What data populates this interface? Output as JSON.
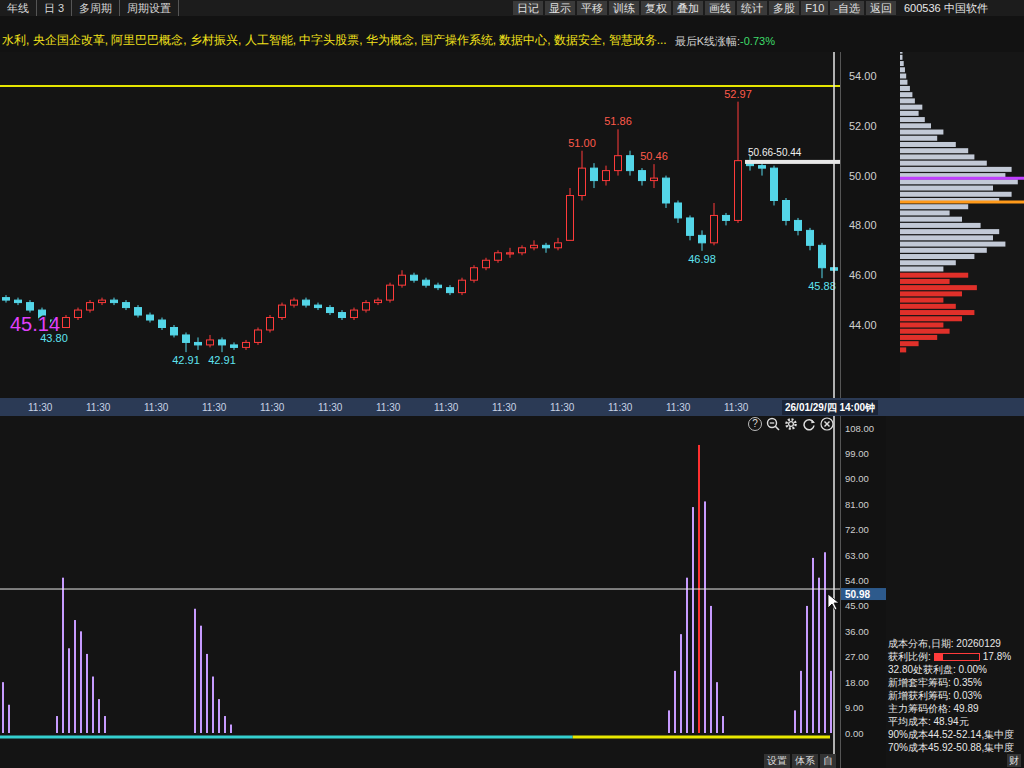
{
  "toolbar": {
    "left": [
      "年线",
      "日 3",
      "多周期",
      "周期设置"
    ],
    "right": [
      "日记",
      "显示",
      "平移",
      "训练",
      "复权",
      "叠加",
      "画线",
      "统计",
      "多股",
      "F10",
      "-自选",
      "返回"
    ],
    "stock": "600536 中国软件"
  },
  "tags": {
    "concepts": "水利, 央企国企改革, 阿里巴巴概念, 乡村振兴, 人工智能, 中字头股票, 华为概念, 国产操作系统, 数据中心, 数据安全, 智慧政务...",
    "last_change_label": "最后K线涨幅:",
    "last_change_value": "-0.73%"
  },
  "chart": {
    "price_ticks": [
      {
        "label": "54.00",
        "value": 54
      },
      {
        "label": "52.00",
        "value": 52
      },
      {
        "label": "50.00",
        "value": 50
      },
      {
        "label": "48.00",
        "value": 48
      },
      {
        "label": "46.00",
        "value": 46
      },
      {
        "label": "44.00",
        "value": 44
      }
    ],
    "resistance_line": 53.6,
    "candles": [
      [
        45.1,
        45.2,
        44.9,
        45.0
      ],
      [
        45.0,
        45.1,
        44.8,
        44.9
      ],
      [
        44.9,
        45.0,
        44.5,
        44.6
      ],
      [
        44.6,
        44.7,
        44.1,
        44.2
      ],
      [
        44.2,
        44.3,
        43.8,
        43.9
      ],
      [
        43.9,
        44.4,
        43.9,
        44.3
      ],
      [
        44.3,
        44.7,
        44.2,
        44.6
      ],
      [
        44.6,
        45.0,
        44.5,
        44.9
      ],
      [
        44.9,
        45.1,
        44.8,
        45.0
      ],
      [
        45.0,
        45.1,
        44.8,
        44.9
      ],
      [
        44.9,
        45.0,
        44.6,
        44.7
      ],
      [
        44.7,
        44.8,
        44.3,
        44.4
      ],
      [
        44.4,
        44.5,
        44.1,
        44.2
      ],
      [
        44.2,
        44.3,
        43.8,
        43.9
      ],
      [
        43.9,
        44.0,
        43.5,
        43.6
      ],
      [
        43.6,
        43.7,
        42.91,
        43.3
      ],
      [
        43.3,
        43.5,
        43.0,
        43.2
      ],
      [
        43.2,
        43.6,
        43.1,
        43.4
      ],
      [
        43.4,
        43.5,
        42.91,
        43.2
      ],
      [
        43.2,
        43.3,
        43.0,
        43.1
      ],
      [
        43.1,
        43.4,
        43.0,
        43.3
      ],
      [
        43.3,
        43.9,
        43.2,
        43.8
      ],
      [
        43.8,
        44.4,
        43.7,
        44.3
      ],
      [
        44.3,
        44.9,
        44.2,
        44.8
      ],
      [
        44.8,
        45.1,
        44.7,
        45.0
      ],
      [
        45.0,
        45.1,
        44.7,
        44.8
      ],
      [
        44.8,
        44.9,
        44.6,
        44.7
      ],
      [
        44.7,
        44.8,
        44.4,
        44.5
      ],
      [
        44.5,
        44.6,
        44.2,
        44.3
      ],
      [
        44.3,
        44.7,
        44.2,
        44.6
      ],
      [
        44.6,
        45.0,
        44.5,
        44.9
      ],
      [
        44.9,
        45.1,
        44.8,
        45.0
      ],
      [
        45.0,
        45.7,
        44.9,
        45.6
      ],
      [
        45.6,
        46.2,
        45.5,
        46.0
      ],
      [
        46.0,
        46.1,
        45.7,
        45.8
      ],
      [
        45.8,
        45.9,
        45.5,
        45.6
      ],
      [
        45.6,
        45.7,
        45.4,
        45.5
      ],
      [
        45.5,
        45.6,
        45.2,
        45.3
      ],
      [
        45.3,
        45.9,
        45.2,
        45.8
      ],
      [
        45.8,
        46.4,
        45.7,
        46.3
      ],
      [
        46.3,
        46.7,
        46.2,
        46.6
      ],
      [
        46.6,
        47.0,
        46.5,
        46.9
      ],
      [
        46.9,
        47.1,
        46.7,
        46.9
      ],
      [
        46.9,
        47.2,
        46.8,
        47.1
      ],
      [
        47.1,
        47.4,
        47.0,
        47.2
      ],
      [
        47.2,
        47.3,
        46.9,
        47.1
      ],
      [
        47.1,
        47.5,
        47.0,
        47.3
      ],
      [
        47.4,
        49.5,
        47.4,
        49.2
      ],
      [
        49.2,
        51.0,
        49.0,
        50.3
      ],
      [
        50.3,
        50.5,
        49.5,
        49.8
      ],
      [
        49.8,
        50.4,
        49.6,
        50.2
      ],
      [
        50.2,
        51.86,
        50.0,
        50.8
      ],
      [
        50.8,
        51.0,
        50.0,
        50.2
      ],
      [
        50.2,
        50.3,
        49.6,
        49.8
      ],
      [
        49.8,
        50.46,
        49.5,
        49.9
      ],
      [
        49.9,
        50.0,
        48.7,
        48.9
      ],
      [
        48.9,
        49.0,
        48.1,
        48.3
      ],
      [
        48.3,
        48.4,
        47.4,
        47.6
      ],
      [
        47.6,
        47.8,
        46.98,
        47.3
      ],
      [
        47.3,
        48.9,
        47.2,
        48.4
      ],
      [
        48.4,
        48.5,
        48.0,
        48.2
      ],
      [
        48.2,
        52.97,
        48.1,
        50.6
      ],
      [
        50.6,
        50.8,
        50.2,
        50.4
      ],
      [
        50.4,
        50.6,
        50.0,
        50.3
      ],
      [
        50.3,
        50.4,
        48.8,
        49.0
      ],
      [
        49.0,
        49.1,
        48.0,
        48.2
      ],
      [
        48.2,
        48.3,
        47.6,
        47.8
      ],
      [
        47.8,
        47.9,
        47.0,
        47.2
      ],
      [
        47.2,
        47.3,
        45.88,
        46.3
      ],
      [
        46.3,
        46.6,
        46.1,
        46.2
      ]
    ],
    "annotations": [
      {
        "text": "43.80",
        "candle": 4,
        "side": "low",
        "color": "#5fe3f0"
      },
      {
        "text": "42.91",
        "candle": 15,
        "side": "low",
        "color": "#5fe3f0"
      },
      {
        "text": "42.91",
        "candle": 18,
        "side": "low",
        "color": "#5fe3f0"
      },
      {
        "text": "51.00",
        "candle": 48,
        "side": "high",
        "color": "#ff5a4a"
      },
      {
        "text": "51.86",
        "candle": 51,
        "side": "high",
        "color": "#ff5a4a"
      },
      {
        "text": "50.46",
        "candle": 54,
        "side": "high",
        "color": "#ff5a4a"
      },
      {
        "text": "46.98",
        "candle": 58,
        "side": "low",
        "color": "#5fe3f0"
      },
      {
        "text": "52.97",
        "candle": 61,
        "side": "high",
        "color": "#ff5a4a"
      },
      {
        "text": "45.88",
        "candle": 68,
        "side": "low",
        "color": "#5fe3f0"
      }
    ],
    "range_label": {
      "text": "50.66-50.44",
      "candle": 62,
      "price": 50.55
    },
    "price_tag": {
      "text": "45.14",
      "color": "#e040fb",
      "price": 44.05
    },
    "crosshair_candle": 69
  },
  "chips": {
    "start": 43,
    "step": 0.25,
    "split_price": 46.2,
    "values": [
      0.05,
      0.15,
      0.3,
      0.4,
      0.35,
      0.5,
      0.6,
      0.45,
      0.35,
      0.5,
      0.62,
      0.4,
      0.55,
      0.35,
      0.45,
      0.6,
      0.7,
      0.85,
      0.75,
      0.8,
      0.65,
      0.5,
      0.4,
      0.55,
      0.8,
      0.9,
      0.75,
      0.95,
      0.85,
      0.9,
      0.7,
      0.6,
      0.55,
      0.45,
      0.3,
      0.35,
      0.25,
      0.2,
      0.15,
      0.18,
      0.12,
      0.1,
      0.08,
      0.06,
      0.05,
      0.04,
      0.03,
      0.02,
      0.02
    ],
    "markers": [
      {
        "price": 49.89,
        "color": "#c040ff"
      },
      {
        "price": 48.94,
        "color": "#ff9a1a"
      }
    ]
  },
  "time_axis": {
    "labels": [
      "11:30",
      "11:30",
      "11:30",
      "11:30",
      "11:30",
      "11:30",
      "11:30",
      "11:30",
      "11:30",
      "11:30",
      "11:30",
      "11:30",
      "11:30"
    ],
    "cursor_date": "26/01/29/四 14:00钟"
  },
  "indicator": {
    "ticks": [
      {
        "label": "108.00",
        "value": 108
      },
      {
        "label": "99.00",
        "value": 99
      },
      {
        "label": "90.00",
        "value": 90
      },
      {
        "label": "81.00",
        "value": 81
      },
      {
        "label": "72.00",
        "value": 72
      },
      {
        "label": "63.00",
        "value": 63
      },
      {
        "label": "54.00",
        "value": 54
      },
      {
        "label": "45.00",
        "value": 45
      },
      {
        "label": "36.00",
        "value": 36
      },
      {
        "label": "27.00",
        "value": 27
      },
      {
        "label": "18.00",
        "value": 18
      },
      {
        "label": "9.00",
        "value": 9
      },
      {
        "label": "0.00",
        "value": 0
      }
    ],
    "values": [
      18,
      10,
      0,
      0,
      0,
      0,
      0,
      0,
      0,
      6,
      55,
      30,
      40,
      36,
      28,
      20,
      12,
      6,
      0,
      0,
      0,
      0,
      0,
      0,
      0,
      0,
      0,
      0,
      0,
      0,
      0,
      0,
      44,
      38,
      28,
      20,
      12,
      6,
      3,
      0,
      0,
      0,
      0,
      0,
      0,
      0,
      0,
      0,
      0,
      0,
      0,
      0,
      0,
      0,
      0,
      0,
      0,
      0,
      0,
      0,
      0,
      0,
      0,
      0,
      0,
      0,
      0,
      0,
      0,
      0,
      0,
      0,
      0,
      0,
      0,
      0,
      0,
      0,
      0,
      0,
      0,
      0,
      0,
      0,
      0,
      0,
      0,
      0,
      0,
      0,
      0,
      0,
      0,
      0,
      0,
      0,
      0,
      0,
      0,
      0,
      0,
      0,
      0,
      0,
      0,
      0,
      0,
      0,
      0,
      0,
      0,
      8,
      22,
      35,
      55,
      80,
      102,
      82,
      45,
      18,
      6,
      0,
      0,
      0,
      0,
      0,
      0,
      0,
      0,
      0,
      0,
      0,
      8,
      22,
      45,
      62,
      55,
      64,
      22,
      0
    ],
    "highlight": {
      "index": 116,
      "color": "#ff3030"
    },
    "crosshair_value": 50.98,
    "crosshair_label": "50.98",
    "band": [
      {
        "color": "#35d0d0",
        "level": 0.69
      },
      {
        "color": "#e8e800",
        "level": 0.31
      }
    ],
    "help_icon": "?",
    "buttons": [
      "设置",
      "体系",
      "自"
    ]
  },
  "info": {
    "title": "成本分布,日期: 20260129",
    "profit": {
      "label": "获利比例:",
      "level": 0.178,
      "value": "17.8%"
    },
    "rows": [
      "32.80处获利盘: 0.00%",
      "新增套牢筹码: 0.35%",
      "新增获利筹码: 0.03%",
      "主力筹码价格: 49.89",
      "平均成本: 48.94元",
      "90%成本44.52-52.14,集中度",
      "70%成本45.92-50.88,集中度"
    ],
    "tab": "财"
  }
}
